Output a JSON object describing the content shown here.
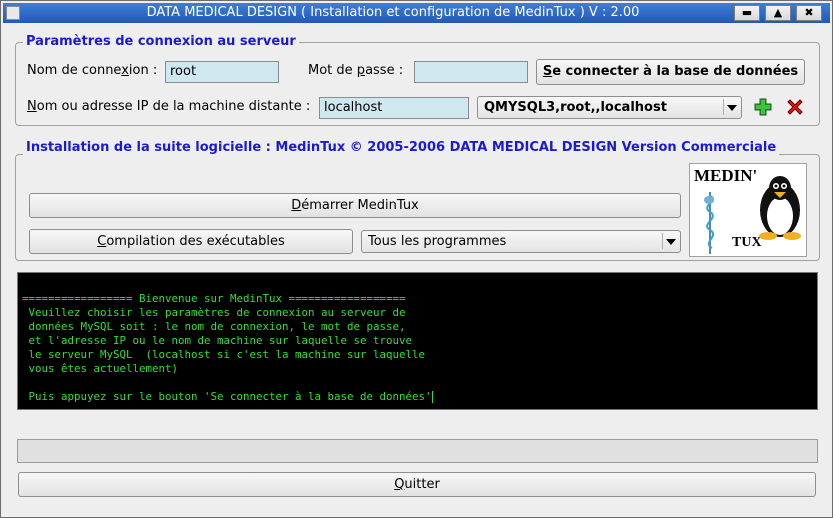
{
  "window": {
    "title": "DATA MEDICAL DESIGN   ( Installation et configuration de MedinTux ) V : 2.00",
    "buttons": {
      "minimize": "▬",
      "maximize": "▲",
      "close": "✖"
    }
  },
  "connection": {
    "group_title": "Paramètres de connexion au serveur",
    "login_label_pre": "Nom de conne",
    "login_label_u": "x",
    "login_label_post": "ion :",
    "login_value": "root",
    "password_label_pre": "Mot de ",
    "password_label_u": "p",
    "password_label_post": "asse :",
    "password_value": "",
    "connect_button_u": "S",
    "connect_button_rest": "e connecter à la base de données",
    "host_label_u": "N",
    "host_label_rest": "om ou adresse IP de la machine distante :",
    "host_value": "localhost",
    "profile_selected": "QMYSQL3,root,,localhost"
  },
  "install": {
    "group_title": "Installation de la suite logicielle : MedinTux © 2005-2006 DATA MEDICAL DESIGN  Version Commerciale",
    "start_button_u": "D",
    "start_button_rest": "émarrer MedinTux",
    "compile_button_u": "C",
    "compile_button_rest": "ompilation des exécutables",
    "programs_selected": "Tous les programmes",
    "logo_top": "MEDIN'",
    "logo_bottom": "TUX"
  },
  "console": {
    "lines": [
      "================= Bienvenue sur MedinTux ==================",
      " Veuillez choisir les paramètres de connexion au serveur de",
      " données MySQL soit : le nom de connexion, le mot de passe,",
      " et l'adresse IP ou le nom de machine sur laquelle se trouve",
      " le serveur MySQL  (localhost si c'est la machine sur laquelle",
      " vous êtes actuellement)",
      "",
      " Puis appuyez sur le bouton 'Se connecter à la base de données'"
    ]
  },
  "progress": {
    "value": 0
  },
  "quit": {
    "label_u": "Q",
    "label_rest": "uitter"
  },
  "colors": {
    "title_bar": "#2d66c8",
    "group_title": "#1a1ad6",
    "field_bg": "#cfe7ef",
    "console_bg": "#000000",
    "console_text": "#2fe02f"
  }
}
